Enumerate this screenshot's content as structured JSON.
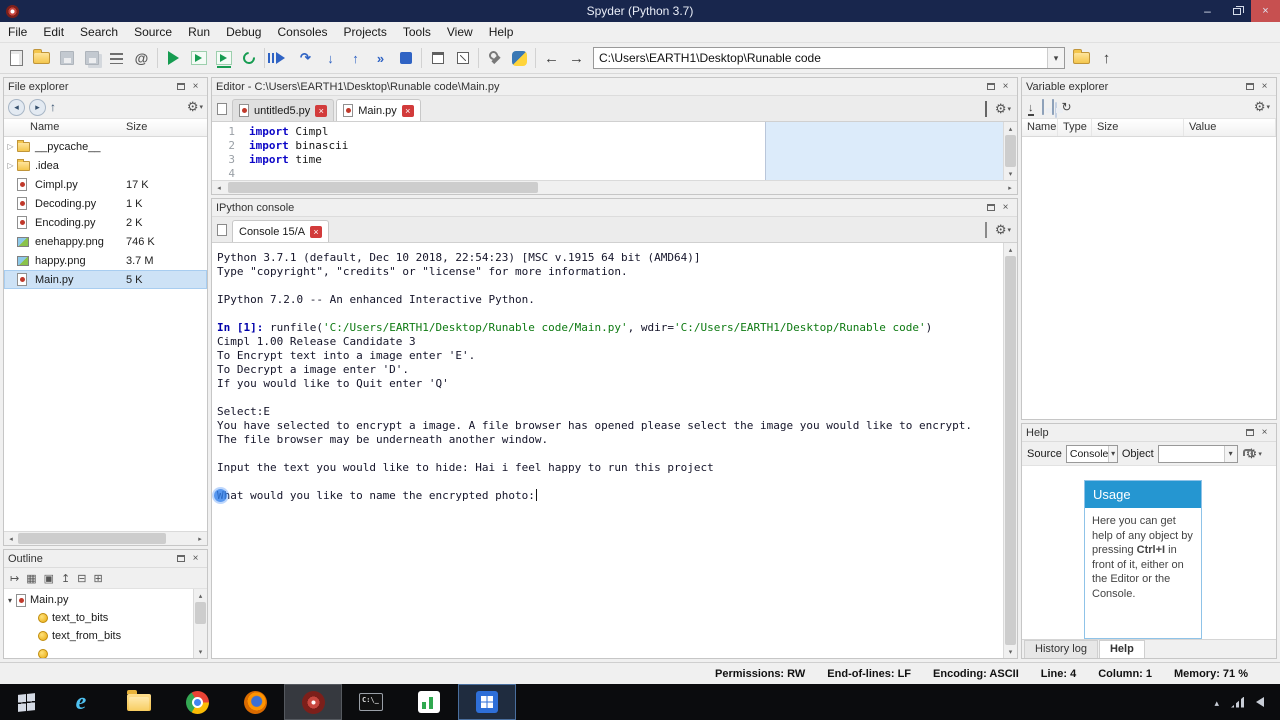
{
  "icons": {
    "close": "×",
    "minimize": "–",
    "dropdown": "▾",
    "expand": "▷",
    "collapse": "▾",
    "back": "←",
    "forward": "→",
    "up": "↑",
    "left": "◂",
    "right": "▸",
    "tri_up": "▴",
    "tri_down": "▾",
    "gear": "⚙",
    "at": "@",
    "refresh": "↻",
    "import_arrow": "↓",
    "step": "↷",
    "step_into": "↓",
    "step_return": "↑",
    "continue": "»",
    "follow": "↦",
    "grid": "▦",
    "panel": "▣",
    "goup": "↥",
    "collapse_box": "⊟",
    "expand_box": "⊞"
  },
  "titlebar": {
    "title": "Spyder (Python 3.7)"
  },
  "menubar": {
    "items": [
      "File",
      "Edit",
      "Search",
      "Source",
      "Run",
      "Debug",
      "Consoles",
      "Projects",
      "Tools",
      "View",
      "Help"
    ]
  },
  "toolbar": {
    "path_value": "C:\\Users\\EARTH1\\Desktop\\Runable code"
  },
  "file_explorer": {
    "title": "File explorer",
    "col_name": "Name",
    "col_size": "Size",
    "items": [
      {
        "name": "__pycache__",
        "size": "",
        "kind": "folder"
      },
      {
        "name": ".idea",
        "size": "",
        "kind": "folder"
      },
      {
        "name": "Cimpl.py",
        "size": "17 K",
        "kind": "py"
      },
      {
        "name": "Decoding.py",
        "size": "1 K",
        "kind": "py"
      },
      {
        "name": "Encoding.py",
        "size": "2 K",
        "kind": "py"
      },
      {
        "name": "enehappy.png",
        "size": "746 K",
        "kind": "img"
      },
      {
        "name": "happy.png",
        "size": "3.7 M",
        "kind": "img"
      },
      {
        "name": "Main.py",
        "size": "5 K",
        "kind": "py",
        "selected": true
      }
    ]
  },
  "outline": {
    "title": "Outline",
    "root_label": "Main.py",
    "items": [
      {
        "label": "text_to_bits"
      },
      {
        "label": "text_from_bits"
      },
      {
        "label": ""
      }
    ]
  },
  "editor": {
    "title": "Editor - C:\\Users\\EARTH1\\Desktop\\Runable code\\Main.py",
    "tabs": [
      {
        "label": "untitled5.py",
        "active": false
      },
      {
        "label": "Main.py",
        "active": true
      }
    ],
    "lines": [
      {
        "num": "1",
        "segments": [
          {
            "t": "import",
            "c": "kw"
          },
          {
            "t": " Cimpl",
            "c": "pl"
          }
        ]
      },
      {
        "num": "2",
        "segments": [
          {
            "t": "import",
            "c": "kw"
          },
          {
            "t": " binascii",
            "c": "pl"
          }
        ]
      },
      {
        "num": "3",
        "segments": [
          {
            "t": "import",
            "c": "kw"
          },
          {
            "t": " time",
            "c": "pl"
          }
        ]
      },
      {
        "num": "4",
        "segments": []
      }
    ]
  },
  "console": {
    "title": "IPython console",
    "tab_label": "Console 15/A",
    "lines": [
      [
        {
          "t": "Python 3.7.1 (default, Dec 10 2018, 22:54:23) [MSC v.1915 64 bit (AMD64)]",
          "c": "pl"
        }
      ],
      [
        {
          "t": "Type \"copyright\", \"credits\" or \"license\" for more information.",
          "c": "pl"
        }
      ],
      [],
      [
        {
          "t": "IPython 7.2.0 -- An enhanced Interactive Python.",
          "c": "pl"
        }
      ],
      [],
      [
        {
          "t": "In [1]:",
          "c": "prompt"
        },
        {
          "t": " runfile(",
          "c": "pl"
        },
        {
          "t": "'C:/Users/EARTH1/Desktop/Runable code/Main.py'",
          "c": "str"
        },
        {
          "t": ", wdir=",
          "c": "pl"
        },
        {
          "t": "'C:/Users/EARTH1/Desktop/Runable code'",
          "c": "str"
        },
        {
          "t": ")",
          "c": "pl"
        }
      ],
      [
        {
          "t": "Cimpl 1.00 Release Candidate 3",
          "c": "pl"
        }
      ],
      [
        {
          "t": "To Encrypt text into a image enter 'E'.",
          "c": "pl"
        }
      ],
      [
        {
          "t": "To Decrypt a image enter 'D'.",
          "c": "pl"
        }
      ],
      [
        {
          "t": "If you would like to Quit enter 'Q'",
          "c": "pl"
        }
      ],
      [],
      [
        {
          "t": "Select:E",
          "c": "pl"
        }
      ],
      [
        {
          "t": "You have selected to encrypt a image. A file browser has opened please select the image you would like to encrypt. The file browser may be underneath another window.",
          "c": "pl"
        }
      ],
      [],
      [
        {
          "t": "Input the text you would like to hide: Hai i feel happy to run this project",
          "c": "pl"
        }
      ],
      [],
      [
        {
          "t": "What would you like to name the encrypted photo:",
          "c": "pl",
          "touch": true,
          "cursor": true
        }
      ]
    ]
  },
  "variable_explorer": {
    "title": "Variable explorer",
    "columns": [
      "Name",
      "Type",
      "Size",
      "Value"
    ]
  },
  "help": {
    "title": "Help",
    "source_label": "Source",
    "source_value": "Console",
    "object_label": "Object",
    "usage_title": "Usage",
    "usage_body_1": "Here you can get help of any object by pressing ",
    "usage_kbd": "Ctrl+I",
    "usage_body_2": " in front of it, either on the Editor or the Console.",
    "tabs": [
      {
        "label": "History log",
        "active": false
      },
      {
        "label": "Help",
        "active": true
      }
    ]
  },
  "statusbar": {
    "permissions": "Permissions: RW",
    "eol": "End-of-lines: LF",
    "encoding": "Encoding: ASCII",
    "line": "Line: 4",
    "column": "Column: 1",
    "memory": "Memory: 71 %"
  },
  "taskbar": {
    "buttons": [
      {
        "name": "start"
      },
      {
        "name": "internet-explorer"
      },
      {
        "name": "file-explorer"
      },
      {
        "name": "chrome"
      },
      {
        "name": "firefox"
      },
      {
        "name": "spyder",
        "active": true
      },
      {
        "name": "terminal"
      },
      {
        "name": "green-app"
      },
      {
        "name": "blue-app",
        "highlighted": true
      }
    ],
    "tray": [
      "hidden-icons",
      "network",
      "volume"
    ]
  }
}
